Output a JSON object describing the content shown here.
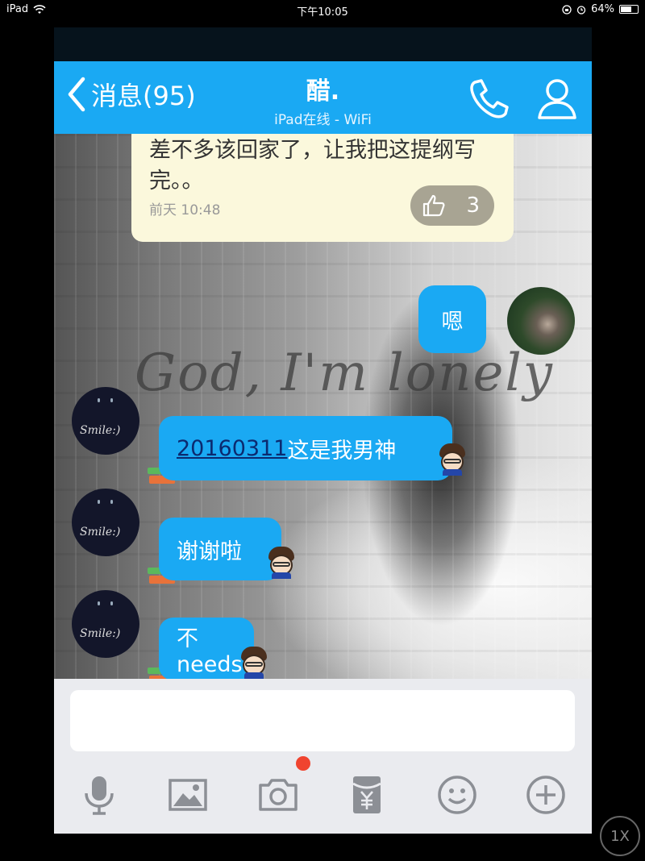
{
  "status_bar": {
    "device": "iPad",
    "time": "下午10:05",
    "battery": "64%",
    "battery_level": 0.64
  },
  "nav": {
    "back_label": "消息(95)",
    "title": "醋.",
    "subtitle": "iPad在线 - WiFi"
  },
  "background_text": "God, I'm lonely",
  "messages": [
    {
      "text": "差不多该回家了，让我把这提纲写完。。",
      "time": "前天 10:48",
      "likes": "3"
    },
    {
      "text": "嗯"
    },
    {
      "link": "20160311",
      "text": "这是我男神"
    },
    {
      "text": "谢谢啦"
    },
    {
      "text": "不needs"
    }
  ],
  "avatar_signature": "Smile:)",
  "toolbar": {
    "icons": [
      "microphone-icon",
      "image-icon",
      "camera-icon",
      "red-envelope-icon",
      "emoji-icon",
      "plus-icon"
    ]
  },
  "zoom_label": "1X",
  "colors": {
    "brand_blue": "#1aa9f3",
    "note_yellow": "#fbf8dc",
    "notification_red": "#f0442f"
  }
}
